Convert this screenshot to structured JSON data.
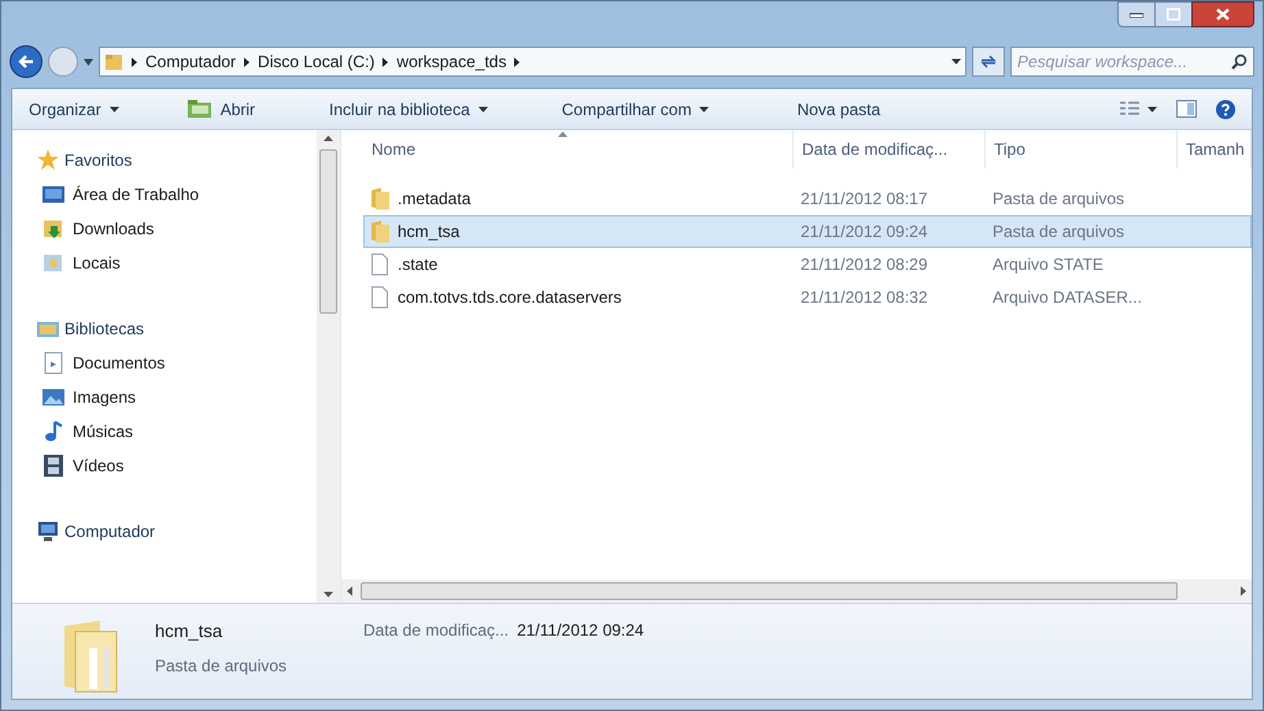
{
  "breadcrumb": [
    "Computador",
    "Disco Local (C:)",
    "workspace_tds"
  ],
  "search": {
    "placeholder": "Pesquisar workspace..."
  },
  "toolbar": [
    {
      "label": "Organizar",
      "dropdown": true,
      "kind": "menu"
    },
    {
      "label": "Abrir",
      "dropdown": false,
      "kind": "open"
    },
    {
      "label": "Incluir na biblioteca",
      "dropdown": true,
      "kind": "menu"
    },
    {
      "label": "Compartilhar com",
      "dropdown": true,
      "kind": "menu"
    },
    {
      "label": "Nova pasta",
      "dropdown": false,
      "kind": "menu"
    }
  ],
  "sidebar": {
    "groups": [
      {
        "label": "Favoritos",
        "kind": "star",
        "children": [
          {
            "label": "Área de Trabalho",
            "kind": "desktop"
          },
          {
            "label": "Downloads",
            "kind": "download"
          },
          {
            "label": "Locais",
            "kind": "places"
          }
        ]
      },
      {
        "label": "Bibliotecas",
        "kind": "library",
        "children": [
          {
            "label": "Documentos",
            "kind": "document"
          },
          {
            "label": "Imagens",
            "kind": "image"
          },
          {
            "label": "Músicas",
            "kind": "music"
          },
          {
            "label": "Vídeos",
            "kind": "video"
          }
        ]
      },
      {
        "label": "Computador",
        "kind": "computer"
      }
    ]
  },
  "table": {
    "columns": [
      "Nome",
      "Data de modificaç...",
      "Tipo",
      "Tamanh"
    ],
    "rows": [
      {
        "name": ".metadata",
        "date": "21/11/2012 08:17",
        "type": "Pasta de arquivos",
        "kind": "folder",
        "selected": false
      },
      {
        "name": "hcm_tsa",
        "date": "21/11/2012 09:24",
        "type": "Pasta de arquivos",
        "kind": "folder",
        "selected": true
      },
      {
        "name": ".state",
        "date": "21/11/2012 08:29",
        "type": "Arquivo STATE",
        "kind": "file",
        "selected": false
      },
      {
        "name": "com.totvs.tds.core.dataservers",
        "date": "21/11/2012 08:32",
        "type": "Arquivo DATASER...",
        "kind": "file",
        "selected": false
      }
    ]
  },
  "details": {
    "name": "hcm_tsa",
    "type": "Pasta de arquivos",
    "date_label": "Data de modificaç...",
    "date": "21/11/2012 09:24"
  }
}
